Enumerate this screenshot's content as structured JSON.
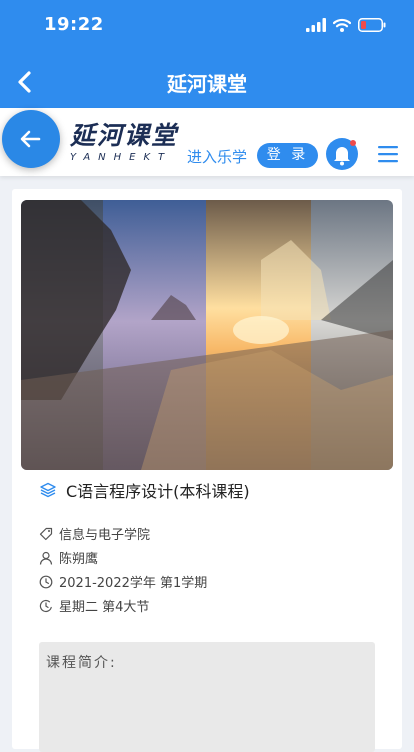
{
  "status_bar": {
    "time": "19:22"
  },
  "nav": {
    "title": "延河课堂"
  },
  "header": {
    "logo_cn": "延河课堂",
    "logo_en": "YANHEKT",
    "enter_link": "进入乐学",
    "login_label": "登 录"
  },
  "course": {
    "title": "C语言程序设计(本科课程)",
    "department": "信息与电子学院",
    "teacher": "陈朔鹰",
    "term": "2021-2022学年 第1学期",
    "schedule": "星期二 第4大节"
  },
  "intro": {
    "label": "课程简介:"
  },
  "colors": {
    "primary": "#2f8cee",
    "logo": "#1c2e55",
    "notification": "#f04b4b"
  }
}
